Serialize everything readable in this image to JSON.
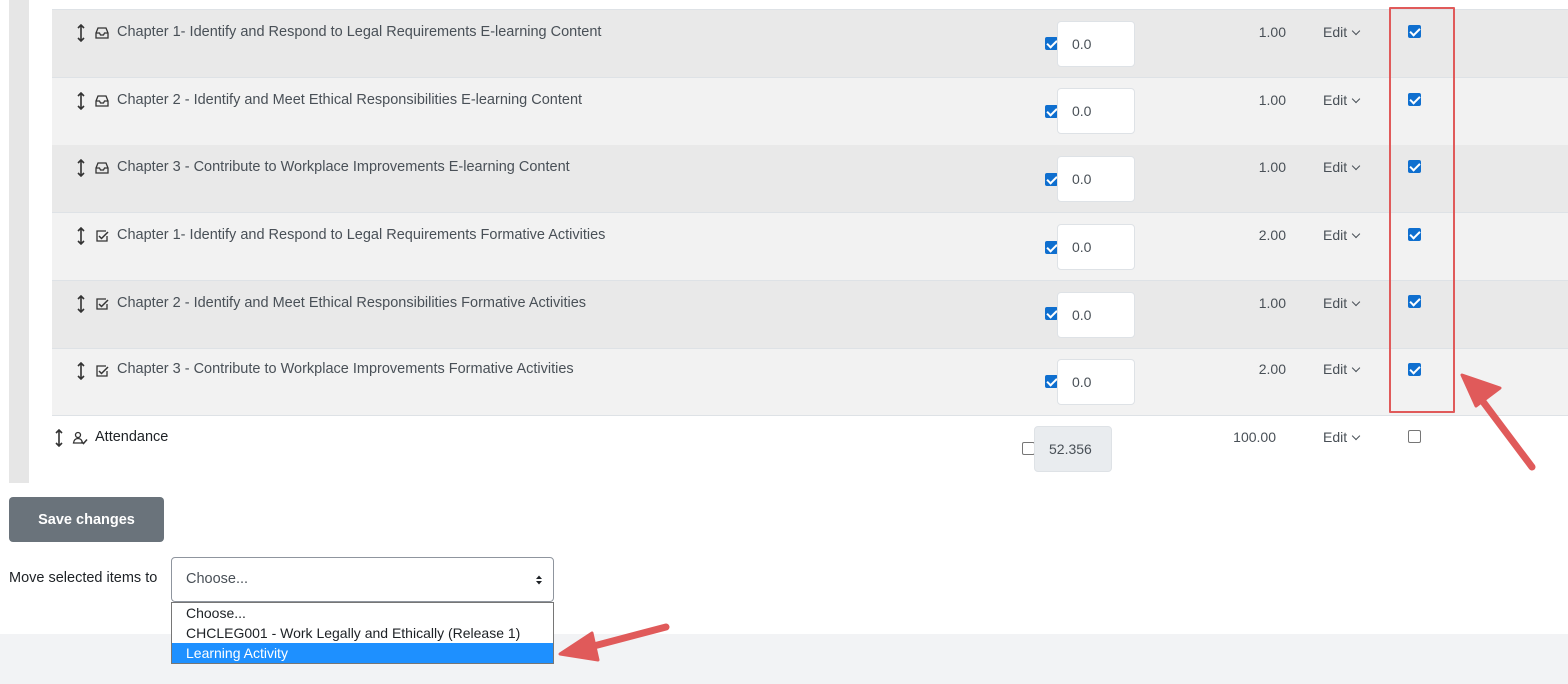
{
  "gradebook": {
    "rows": [
      {
        "name": "Chapter 1- Identify and Respond to Legal Requirements E-learning Content",
        "icon": "inbox-tray-icon",
        "weight_override": true,
        "weight": "0.0",
        "max_grade": "1.00",
        "edit": "Edit",
        "selected": true
      },
      {
        "name": "Chapter 2 - Identify and Meet Ethical Responsibilities E-learning Content",
        "icon": "inbox-tray-icon",
        "weight_override": true,
        "weight": "0.0",
        "max_grade": "1.00",
        "edit": "Edit",
        "selected": true
      },
      {
        "name": "Chapter 3 - Contribute to Workplace Improvements E-learning Content",
        "icon": "inbox-tray-icon",
        "weight_override": true,
        "weight": "0.0",
        "max_grade": "1.00",
        "edit": "Edit",
        "selected": true
      },
      {
        "name": "Chapter 1- Identify and Respond to Legal Requirements Formative Activities",
        "icon": "checkbox-square-icon",
        "weight_override": true,
        "weight": "0.0",
        "max_grade": "2.00",
        "edit": "Edit",
        "selected": true
      },
      {
        "name": "Chapter 2 - Identify and Meet Ethical Responsibilities Formative Activities",
        "icon": "checkbox-square-icon",
        "weight_override": true,
        "weight": "0.0",
        "max_grade": "1.00",
        "edit": "Edit",
        "selected": true
      },
      {
        "name": "Chapter 3 - Contribute to Workplace Improvements Formative Activities",
        "icon": "checkbox-square-icon",
        "weight_override": true,
        "weight": "0.0",
        "max_grade": "2.00",
        "edit": "Edit",
        "selected": true
      }
    ],
    "attendance": {
      "name": "Attendance",
      "icon": "attendance-users-icon",
      "weight_override": false,
      "weight": "52.356",
      "max_grade": "100.00",
      "edit": "Edit",
      "selected": false
    }
  },
  "actions": {
    "save_label": "Save changes",
    "move_label": "Move selected items to",
    "select_value": "Choose...",
    "options": [
      "Choose...",
      "CHCLEG001 - Work Legally and Ethically (Release 1)",
      "Learning Activity"
    ],
    "highlighted_option_index": 2
  },
  "annotations": {
    "highlight_color": "#e05a5a"
  }
}
